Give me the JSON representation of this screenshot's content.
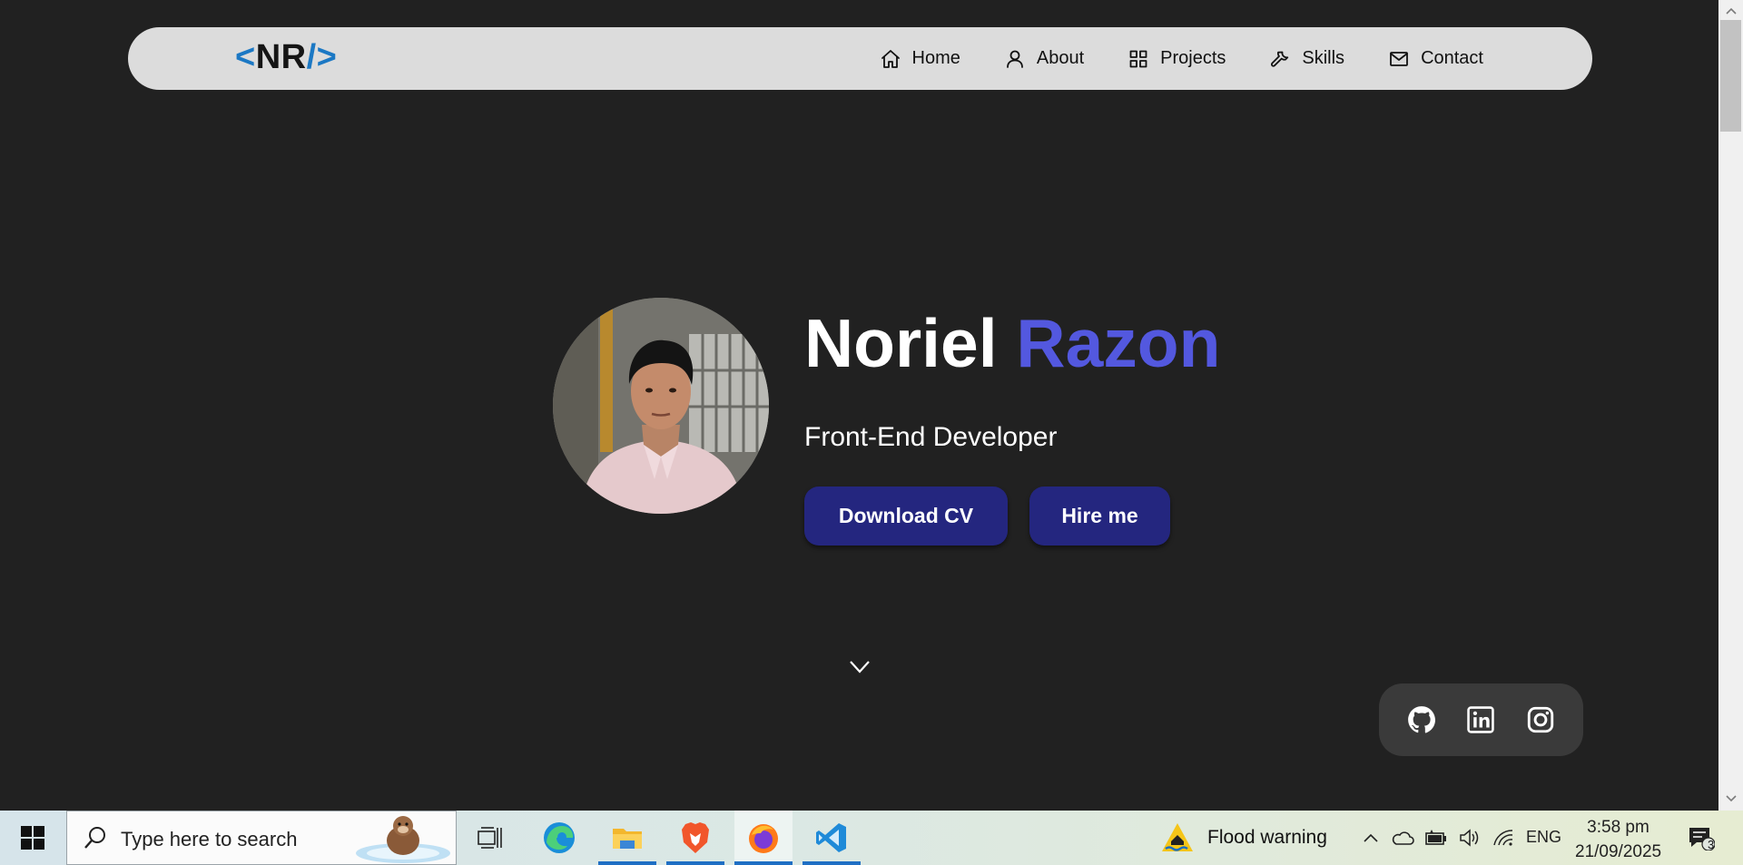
{
  "navbar": {
    "logo_open": "<",
    "logo_initials": "NR",
    "logo_close": "/>",
    "links": [
      {
        "label": "Home",
        "icon": "home-icon"
      },
      {
        "label": "About",
        "icon": "user-icon"
      },
      {
        "label": "Projects",
        "icon": "grid-icon"
      },
      {
        "label": "Skills",
        "icon": "wrench-icon"
      },
      {
        "label": "Contact",
        "icon": "mail-icon"
      }
    ]
  },
  "hero": {
    "first_name": "Noriel",
    "last_name": "Razon",
    "role": "Front-End Developer",
    "download_cv_label": "Download CV",
    "hire_me_label": "Hire me",
    "accent_color": "#5358df",
    "button_color": "#24267f"
  },
  "social": {
    "items": [
      "github-icon",
      "linkedin-icon",
      "instagram-icon"
    ]
  },
  "taskbar": {
    "search_placeholder": "Type here to search",
    "weather_label": "Flood warning",
    "language": "ENG",
    "time": "3:58 pm",
    "date": "21/09/2025",
    "notification_count": "3",
    "apps": [
      "task-view-icon",
      "edge-icon",
      "file-explorer-icon",
      "brave-icon",
      "firefox-icon",
      "vscode-icon"
    ]
  }
}
